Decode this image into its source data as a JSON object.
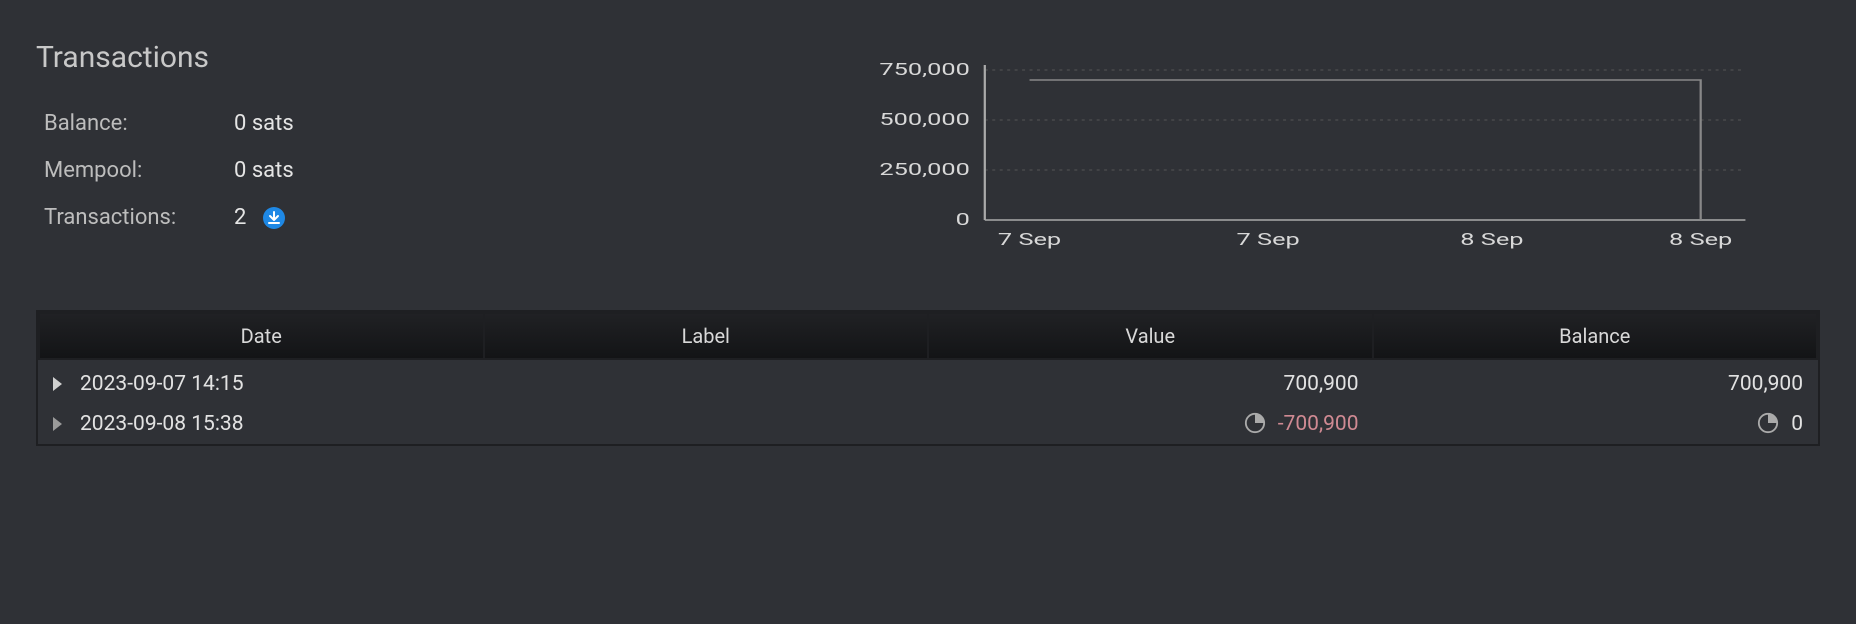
{
  "header": {
    "title": "Transactions"
  },
  "stats": {
    "balance_label": "Balance:",
    "balance_value": "0 sats",
    "mempool_label": "Mempool:",
    "mempool_value": "0 sats",
    "tx_label": "Transactions:",
    "tx_value": "2"
  },
  "chart_data": {
    "type": "line",
    "x": [
      "7 Sep",
      "7 Sep",
      "8 Sep",
      "8 Sep"
    ],
    "values": [
      700900,
      700900,
      700900,
      0
    ],
    "title": "",
    "xlabel": "",
    "ylabel": "",
    "ylim": [
      0,
      750000
    ],
    "yticks": [
      0,
      250000,
      500000,
      750000
    ],
    "ytick_labels": [
      "0",
      "250,000",
      "500,000",
      "750,000"
    ],
    "xtick_labels": [
      "7 Sep",
      "7 Sep",
      "8 Sep",
      "8 Sep"
    ]
  },
  "table": {
    "columns": [
      "Date",
      "Label",
      "Value",
      "Balance"
    ],
    "rows": [
      {
        "date": "2023-09-07 14:15",
        "label": "",
        "value": "700,900",
        "balance": "700,900",
        "pending": false,
        "negative": false
      },
      {
        "date": "2023-09-08 15:38",
        "label": "",
        "value": "-700,900",
        "balance": "0",
        "pending": true,
        "negative": true
      }
    ]
  },
  "colors": {
    "accent": "#1e88e5",
    "negative": "#d08a93"
  }
}
